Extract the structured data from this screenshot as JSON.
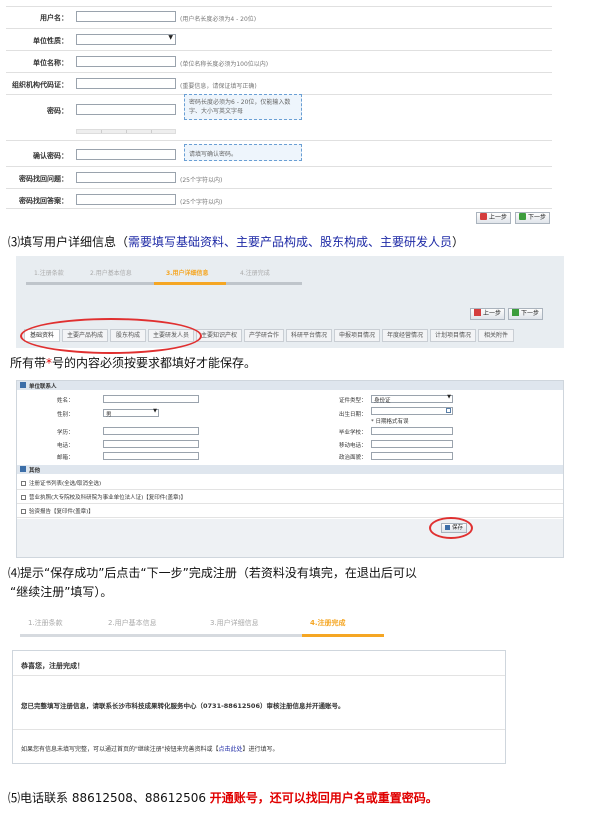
{
  "form1": {
    "rows": [
      {
        "label": "用户名：",
        "hint": "(用户名长度必须为4 - 20位)"
      },
      {
        "label": "单位性质：",
        "hint": ""
      },
      {
        "label": "单位名称：",
        "hint": "(单位名称长度必须为100位以内)"
      },
      {
        "label": "组织机构代码证：",
        "hint": "(重要信息，请保证填写正确)"
      },
      {
        "label": "密码：",
        "hint": ""
      },
      {
        "label": "确认密码：",
        "hint": ""
      },
      {
        "label": "密码找回问题：",
        "hint": "(25个字符以内)"
      },
      {
        "label": "密码找回答案：",
        "hint": "(25个字符以内)"
      }
    ],
    "tip_password": "密码长度必须为6 - 20位，仅能输入数字、大小写英文字母",
    "tip_confirm": "请填写确认密码。",
    "prev_label": "上一步",
    "next_label": "下一步"
  },
  "step3": {
    "prefix": "⑶填写用户详细信息（",
    "highlight": "需要填写基础资料、主要产品构成、股东构成、主要研发人员",
    "suffix": "）"
  },
  "wizard": {
    "steps": [
      "1.注册条款",
      "2.用户基本信息",
      "3.用户详细信息",
      "4.注册完成"
    ],
    "tabs": [
      "基础资料",
      "主要产品构成",
      "股东构成",
      "主要研发人员",
      "主要知识产权",
      "产学研合作",
      "科研平台情况",
      "申报项目情况",
      "年度经营情况",
      "计划项目情况",
      "相关附件"
    ],
    "prev_label": "上一步",
    "next_label": "下一步"
  },
  "note": {
    "prefix": "所有带",
    "star": "*",
    "suffix": "号的内容必须按要求都填好才能保存。"
  },
  "contact": {
    "section_title": "单位联系人",
    "left_labels": [
      "姓名：",
      "性别：",
      "学历：",
      "电话：",
      "邮箱："
    ],
    "right_labels": [
      "证件类型：",
      "出生日期：",
      "毕业学校：",
      "移动电话：",
      "政治面貌："
    ],
    "gender_value": "男",
    "id_type_value": "身份证",
    "date_hint": "* 日期格式有误",
    "other_title": "其他",
    "checks": [
      "注册证书列表(全选/取消全选)",
      "营业执照(大专院校及科研院为事业单位法人证)【复印件(盖章)】",
      "验资报告【复印件(盖章)】"
    ],
    "save_label": "保存"
  },
  "step4": {
    "line1": "⑷提示“保存成功”后点击“下一步”完成注册（若资料没有填完，在退出后可以",
    "line2": "“继续注册”填写）。"
  },
  "done": {
    "steps": [
      "1.注册条款",
      "2.用户基本信息",
      "3.用户详细信息",
      "4.注册完成"
    ],
    "congrats": "恭喜您，注册完成！",
    "notice": "您已完整填写注册信息，请联系长沙市科技成果转化服务中心（0731-88612506）审核注册信息并开通账号。",
    "footer_prefix": "如果您有信息未填写完整，可以通过首页的\"继续注册\"按钮来完善资料或【",
    "footer_link": "点击此处",
    "footer_suffix": "】进行填写。"
  },
  "step5": {
    "prefix": "⑸电话联系 88612508、88612506 ",
    "highlight": "开通账号，还可以找回用户名或重置密码。"
  },
  "colors": {
    "accent_orange": "#f5a623",
    "blue_text": "#1e2aa6",
    "red_text": "#e00000",
    "oval_red": "#e03030"
  }
}
